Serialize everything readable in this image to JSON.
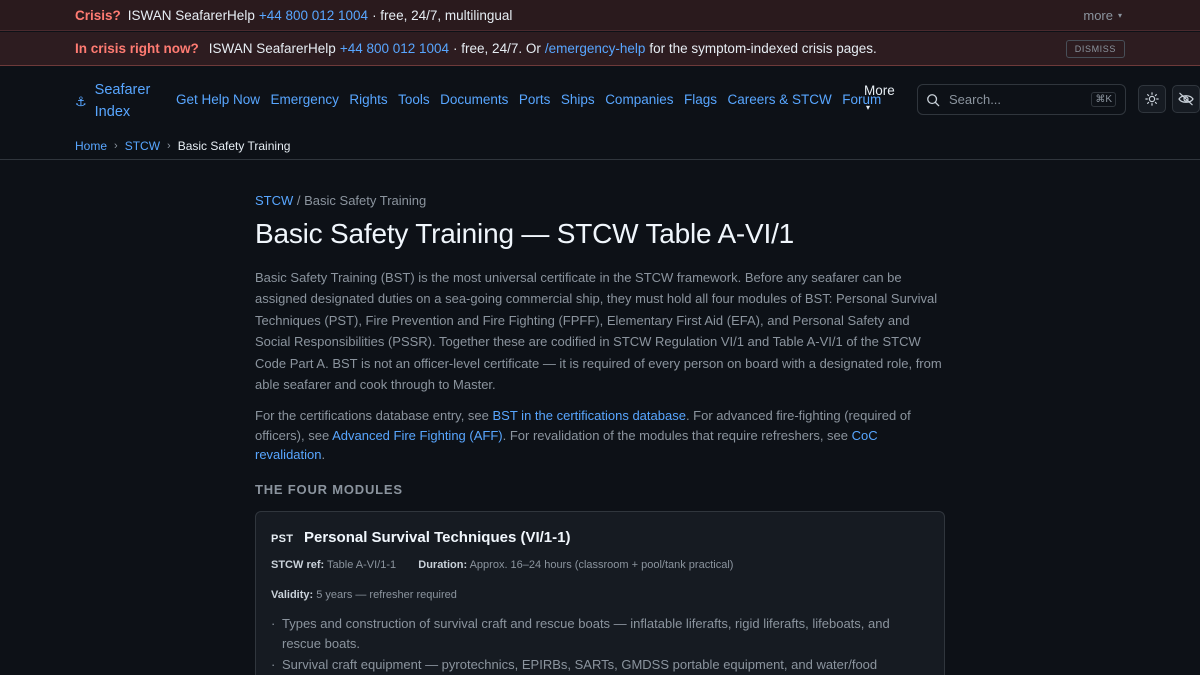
{
  "crisis_strip": {
    "label": "Crisis?",
    "org": "ISWAN SeafarerHelp",
    "phone": "+44 800 012 1004",
    "tail": "· free, 24/7, multilingual",
    "more": "more",
    "more_caret": "▾"
  },
  "crisis_banner": {
    "label": "In crisis right now?",
    "org": "ISWAN SeafarerHelp",
    "phone": "+44 800 012 1004",
    "mid": "· free, 24/7. Or",
    "link": "/emergency-help",
    "tail": "for the symptom-indexed crisis pages.",
    "dismiss": "DISMISS"
  },
  "brand": {
    "icon": "anchor-icon",
    "name_line1": "Seafarer",
    "name_line2": "Index"
  },
  "nav": {
    "items": [
      "Get Help Now",
      "Emergency",
      "Rights",
      "Tools",
      "Documents",
      "Ports",
      "Ships",
      "Companies",
      "Flags",
      "Careers & STCW",
      "Forum"
    ],
    "more": "More",
    "more_caret": "▾"
  },
  "search": {
    "placeholder": "Search...",
    "shortcut": "⌘K"
  },
  "breadcrumb": {
    "home": "Home",
    "section": "STCW",
    "current": "Basic Safety Training",
    "sep": "›"
  },
  "page": {
    "crumb_link": "STCW",
    "crumb_rest": "/ Basic Safety Training",
    "title": "Basic Safety Training — STCW Table A-VI/1",
    "intro": "Basic Safety Training (BST) is the most universal certificate in the STCW framework. Before any seafarer can be assigned designated duties on a sea-going commercial ship, they must hold all four modules of BST: Personal Survival Techniques (PST), Fire Prevention and Fire Fighting (FPFF), Elementary First Aid (EFA), and Personal Safety and Social Responsibilities (PSSR). Together these are codified in STCW Regulation VI/1 and Table A-VI/1 of the STCW Code Part A. BST is not an officer-level certificate — it is required of every person on board with a designated role, from able seafarer and cook through to Master.",
    "intro2": {
      "p1": "For the certifications database entry, see",
      "link1": "BST in the certifications database",
      "p2": ". For advanced fire-fighting (required of officers), see",
      "link2": "Advanced Fire Fighting (AFF)",
      "p3": ". For revalidation of the modules that require refreshers, see",
      "link3": "CoC revalidation",
      "p4": "."
    },
    "section_heading": "THE FOUR MODULES"
  },
  "module": {
    "code": "PST",
    "title": "Personal Survival Techniques (VI/1-1)",
    "ref_label": "STCW ref:",
    "ref_value": "Table A-VI/1-1",
    "duration_label": "Duration:",
    "duration_value": "Approx. 16–24 hours (classroom + pool/tank practical)",
    "validity_label": "Validity:",
    "validity_value": "5 years — refresher required",
    "bullets": [
      "Types and construction of survival craft and rescue boats — inflatable liferafts, rigid liferafts, lifeboats, and rescue boats.",
      "Survival craft equipment — pyrotechnics, EPIRBs, SARTs, GMDSS portable equipment, and water/food rations."
    ]
  },
  "colors": {
    "bg": "#0d1117",
    "accent": "#58a6ff",
    "crisis": "#ff7b72",
    "border": "#30363d"
  }
}
